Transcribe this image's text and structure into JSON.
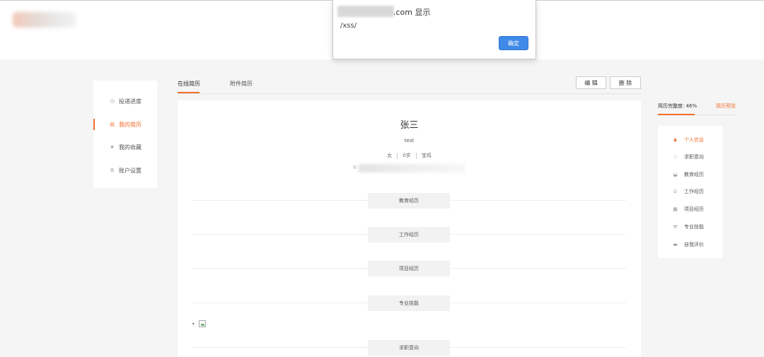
{
  "dialog": {
    "title_suffix": ".com 显示",
    "message": "/xss/",
    "ok_label": "确定"
  },
  "left_nav": {
    "items": [
      {
        "label": "投递进度",
        "icon": "clock-icon",
        "glyph": "◷",
        "active": false
      },
      {
        "label": "我的简历",
        "icon": "resume-icon",
        "glyph": "▤",
        "active": true
      },
      {
        "label": "我的收藏",
        "icon": "star-icon",
        "glyph": "★",
        "active": false
      },
      {
        "label": "账户设置",
        "icon": "gear-icon",
        "glyph": "⚙",
        "active": false
      }
    ]
  },
  "tabs": [
    {
      "label": "在线简历",
      "active": true
    },
    {
      "label": "附件简历",
      "active": false
    }
  ],
  "toolbar": {
    "edit_label": "编 辑",
    "delete_label": "删 除"
  },
  "resume": {
    "name": "张三",
    "subtitle": "test",
    "gender": "女",
    "age": "0岁",
    "status": "宝鸡",
    "sections": [
      "教育经历",
      "工作经历",
      "项目经历",
      "专业技能",
      "求职意向"
    ]
  },
  "completeness": {
    "label": "简历完整度: 46%",
    "percent": 46,
    "preview_label": "简历预览",
    "accent_color": "#f06d2c"
  },
  "right_nav": {
    "items": [
      {
        "label": "个人信息",
        "icon": "person-icon",
        "glyph": "♟",
        "active": true
      },
      {
        "label": "求职意向",
        "icon": "hand-icon",
        "glyph": "☝",
        "active": false
      },
      {
        "label": "教育经历",
        "icon": "graduation-icon",
        "glyph": "◒",
        "active": false
      },
      {
        "label": "工作经历",
        "icon": "briefcase-icon",
        "glyph": "⌸",
        "active": false
      },
      {
        "label": "项目经历",
        "icon": "document-icon",
        "glyph": "▦",
        "active": false
      },
      {
        "label": "专业技能",
        "icon": "wrench-icon",
        "glyph": "⚒",
        "active": false
      },
      {
        "label": "自我评价",
        "icon": "comment-icon",
        "glyph": "▬",
        "active": false
      }
    ]
  }
}
